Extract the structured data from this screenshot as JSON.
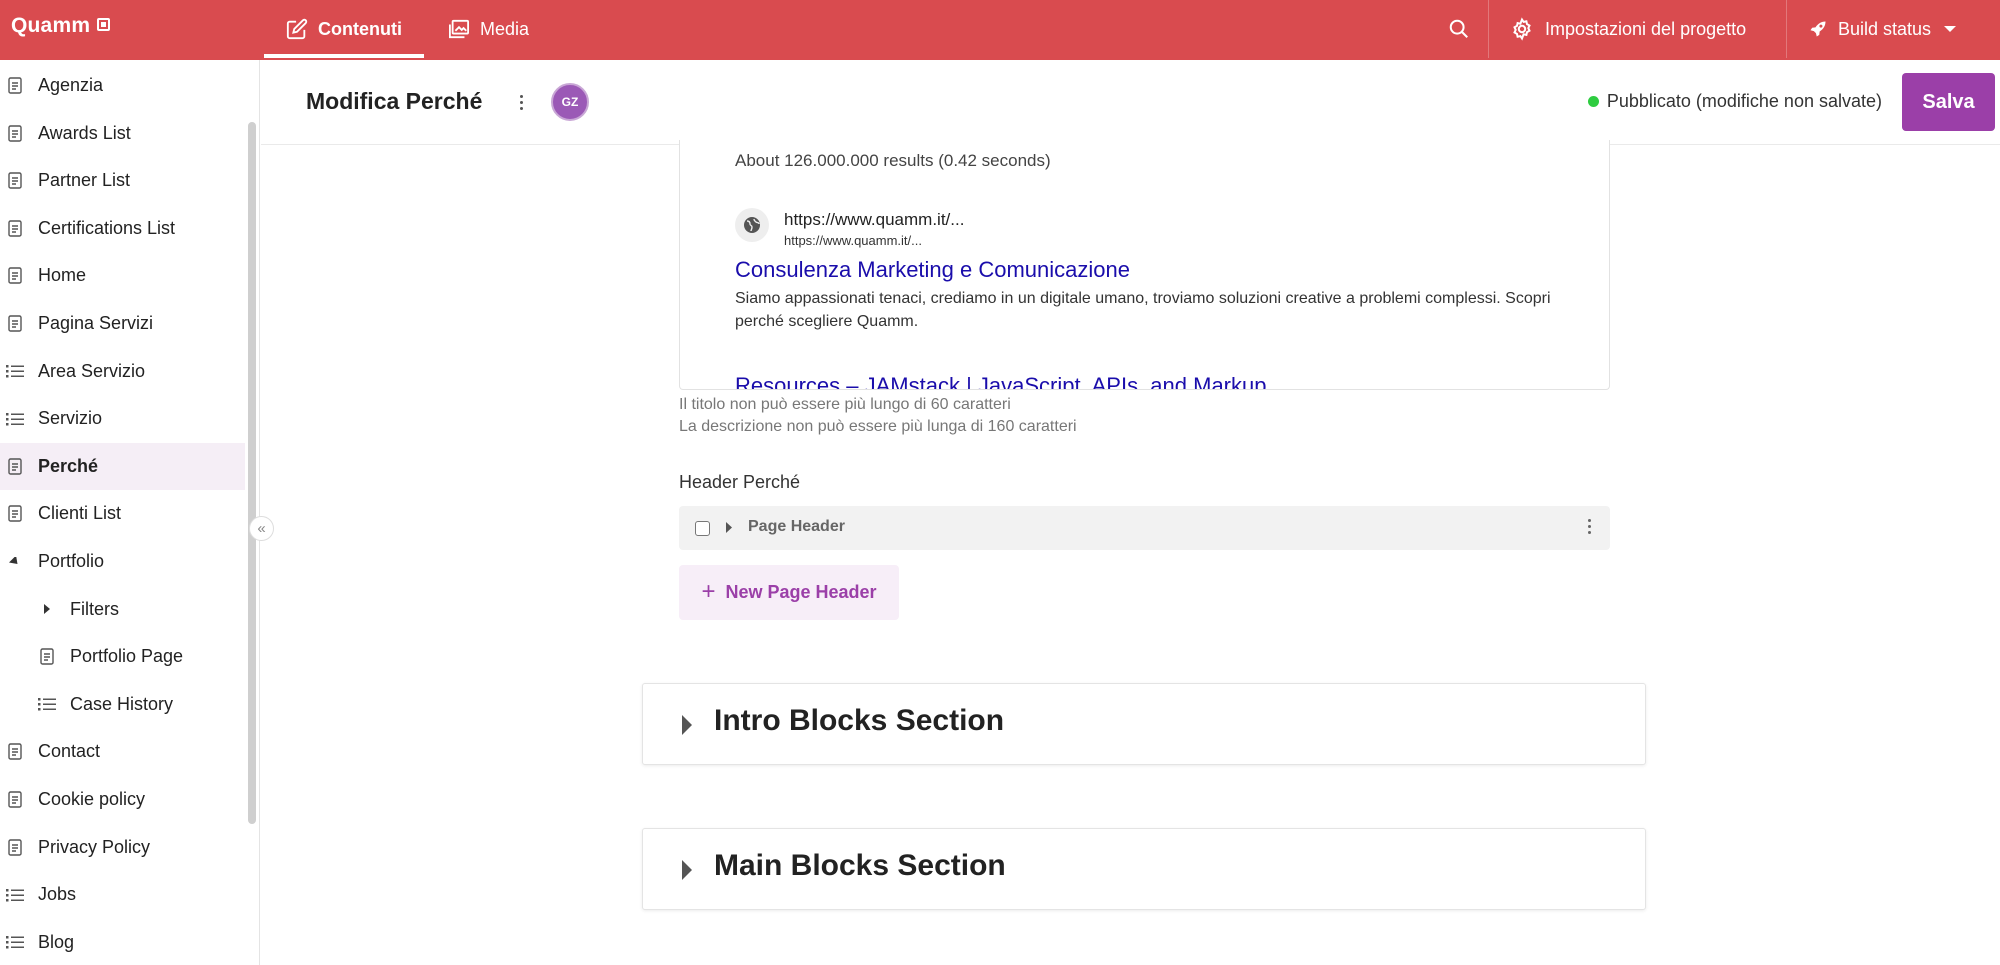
{
  "topbar": {
    "brand": "Quamm",
    "tabs": [
      {
        "label": "Contenuti",
        "icon": "edit-icon"
      },
      {
        "label": "Media",
        "icon": "image-icon"
      }
    ],
    "settings_label": "Impostazioni del progetto",
    "build_status_label": "Build status",
    "colors": {
      "bar": "#d94b4f"
    }
  },
  "sidebar": {
    "items": [
      {
        "label": "Agenzia",
        "icon": "page-icon"
      },
      {
        "label": "Awards List",
        "icon": "page-icon"
      },
      {
        "label": "Partner List",
        "icon": "page-icon"
      },
      {
        "label": "Certifications List",
        "icon": "page-icon"
      },
      {
        "label": "Home",
        "icon": "page-icon"
      },
      {
        "label": "Pagina Servizi",
        "icon": "page-icon"
      },
      {
        "label": "Area Servizio",
        "icon": "list-icon"
      },
      {
        "label": "Servizio",
        "icon": "list-icon"
      },
      {
        "label": "Perché",
        "icon": "page-icon",
        "active": true
      },
      {
        "label": "Clienti List",
        "icon": "page-icon"
      },
      {
        "label": "Portfolio",
        "icon": "triangle-down-icon"
      },
      {
        "label": "Filters",
        "icon": "triangle-right-icon"
      },
      {
        "label": "Portfolio Page",
        "icon": "page-icon"
      },
      {
        "label": "Case History",
        "icon": "list-icon"
      },
      {
        "label": "Contact",
        "icon": "page-icon"
      },
      {
        "label": "Cookie policy",
        "icon": "page-icon"
      },
      {
        "label": "Privacy Policy",
        "icon": "page-icon"
      },
      {
        "label": "Jobs",
        "icon": "list-icon"
      },
      {
        "label": "Blog",
        "icon": "list-icon"
      }
    ]
  },
  "editor": {
    "title": "Modifica Perché",
    "avatar_initials": "GZ",
    "status": "Pubblicato (modifiche non salvate)",
    "save_label": "Salva"
  },
  "preview": {
    "results_count": "About 126.000.000 results (0.42 seconds)",
    "url_primary": "https://www.quamm.it/...",
    "url_secondary": "https://www.quamm.it/...",
    "title": "Consulenza Marketing e Comunicazione",
    "description": "Siamo appassionati tenaci, crediamo in un digitale umano, troviamo soluzioni creative a problemi complessi. Scopri perché scegliere Quamm.",
    "next_title": "Resources – JAMstack | JavaScript, APIs, and Markup"
  },
  "hints": {
    "title_limit": "Il titolo non può essere più lungo di 60 caratteri",
    "description_limit": "La descrizione non può essere più lunga di 160 caratteri"
  },
  "header_field": {
    "label": "Header Perché",
    "item_label": "Page Header",
    "new_button": "New Page Header"
  },
  "sections": [
    {
      "title": "Intro Blocks Section"
    },
    {
      "title": "Main Blocks Section"
    }
  ],
  "colors": {
    "accent": "#9b3fa8",
    "status_dot": "#2ecc40",
    "link": "#1a0dab"
  }
}
